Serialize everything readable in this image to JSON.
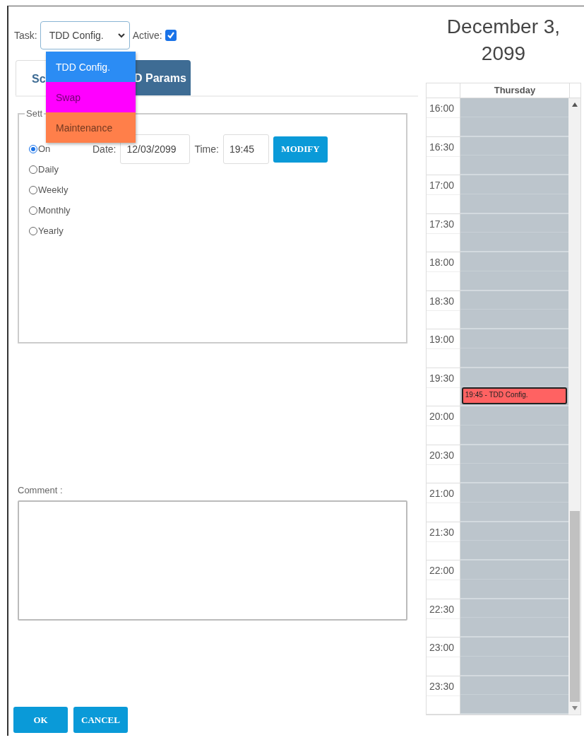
{
  "task_bar": {
    "task_label": "Task:",
    "task_value": "TDD Config.",
    "active_label": "Active:",
    "active_checked": true
  },
  "task_dropdown": {
    "expanded": true,
    "options": [
      {
        "label": "TDD Config.",
        "selected": true,
        "color": "#2b8cf4"
      },
      {
        "label": "Swap",
        "selected": false,
        "color": "#ff00ff"
      },
      {
        "label": "Maintenance",
        "selected": false,
        "color": "#ff7f4a"
      }
    ]
  },
  "tabs": [
    {
      "label": "Sc",
      "selected": true
    },
    {
      "label": "D Params",
      "selected": false
    }
  ],
  "schedule": {
    "legend": "Sett",
    "recurrence": [
      {
        "label": "On",
        "selected": true
      },
      {
        "label": "Daily",
        "selected": false
      },
      {
        "label": "Weekly",
        "selected": false
      },
      {
        "label": "Monthly",
        "selected": false
      },
      {
        "label": "Yearly",
        "selected": false
      }
    ],
    "date_label": "Date:",
    "date_value": "12/03/2099",
    "time_label": "Time:",
    "time_value": "19:45",
    "modify_button": "MODIFY"
  },
  "comment": {
    "label": "Comment :"
  },
  "buttons": [
    "OK",
    "CANCEL"
  ],
  "calendar": {
    "title": "December 3, 2099",
    "day": "Thursday",
    "slots": [
      {
        "time": "16:00"
      },
      {
        "time": "16:30"
      },
      {
        "time": "17:00"
      },
      {
        "time": "17:30"
      },
      {
        "time": "18:00"
      },
      {
        "time": "18:30"
      },
      {
        "time": "19:00"
      },
      {
        "time": "19:30",
        "event": {
          "label": "19:45 - TDD Config.",
          "in_second_half": true
        }
      },
      {
        "time": "20:00"
      },
      {
        "time": "20:30"
      },
      {
        "time": "21:00"
      },
      {
        "time": "21:30"
      },
      {
        "time": "22:00"
      },
      {
        "time": "22:30"
      },
      {
        "time": "23:00"
      },
      {
        "time": "23:30"
      }
    ]
  }
}
